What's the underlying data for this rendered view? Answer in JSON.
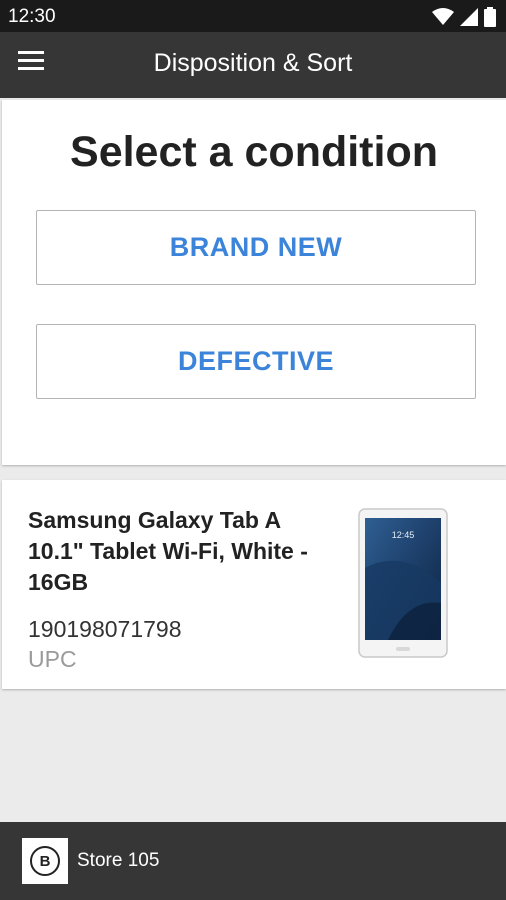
{
  "status_bar": {
    "time": "12:30"
  },
  "app_bar": {
    "title": "Disposition & Sort"
  },
  "condition": {
    "heading": "Select a condition",
    "options": [
      {
        "label": "BRAND NEW"
      },
      {
        "label": "DEFECTIVE"
      }
    ]
  },
  "product": {
    "name": "Samsung Galaxy Tab A 10.1\" Tablet Wi-Fi, White - 16GB",
    "upc_value": "190198071798",
    "upc_label": "UPC",
    "image_time": "12:45"
  },
  "footer": {
    "store_name": "Store 105",
    "logo_letter": "B"
  },
  "colors": {
    "accent_blue": "#3b84d9",
    "app_bar_bg": "#363636",
    "status_bar_bg": "#1a1a1a",
    "page_bg": "#ebebeb"
  },
  "icons": [
    "menu-icon",
    "wifi-icon",
    "signal-icon",
    "battery-icon",
    "store-logo-icon"
  ]
}
